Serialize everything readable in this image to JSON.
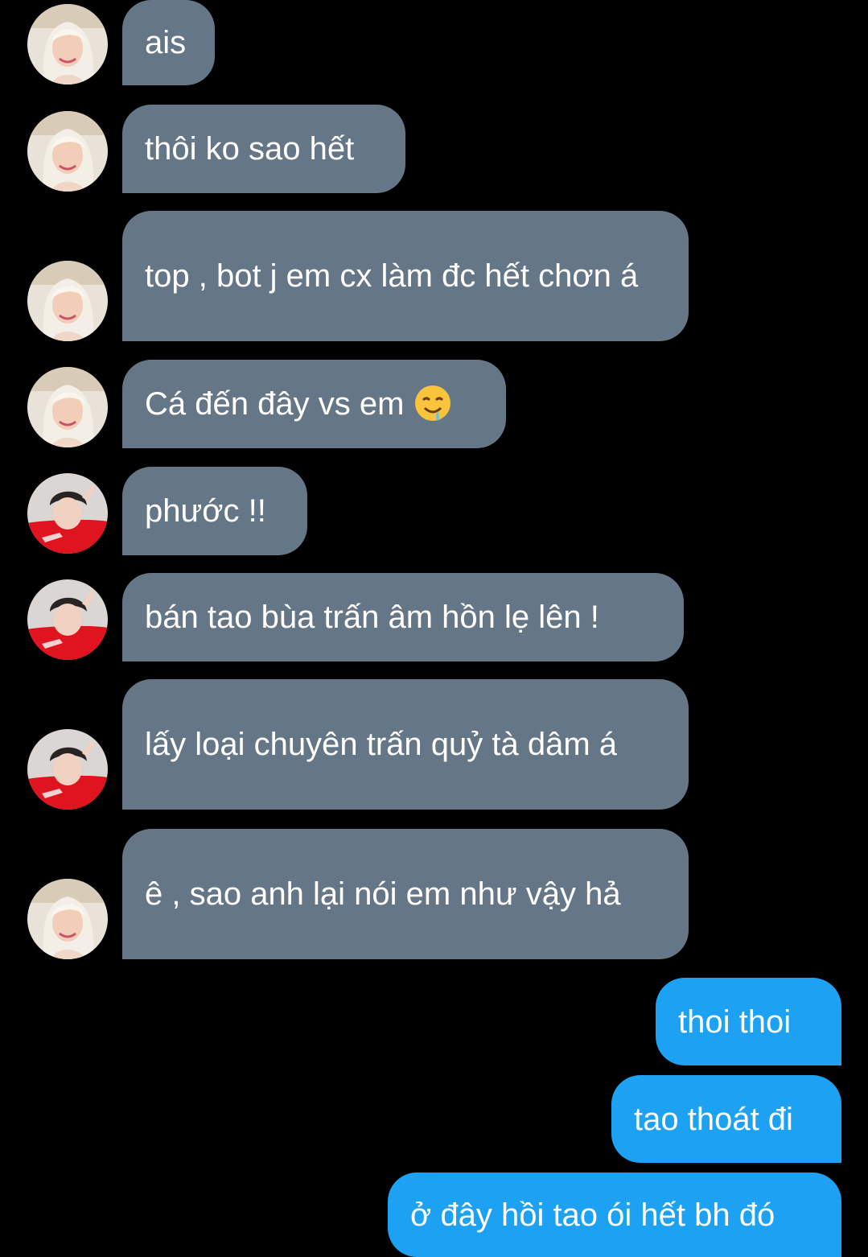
{
  "conversation": {
    "messages": [
      {
        "text": "ais"
      },
      {
        "text": "thôi ko sao hết"
      },
      {
        "text": "top , bot j em cx làm đc hết chơn á"
      },
      {
        "text": "Cá đến đây vs em",
        "emoji": "drooling-face-emoji"
      },
      {
        "text": "phước !!"
      },
      {
        "text": "bán tao bùa trấn âm hồn lẹ lên !"
      },
      {
        "text": "lấy loại chuyên trấn quỷ tà dâm á"
      },
      {
        "text": "ê , sao anh lại nói em như vậy hả"
      },
      {
        "text": "thoi thoi"
      },
      {
        "text": "tao thoát đi"
      },
      {
        "text": "ở đây hồi tao ói hết bh đó"
      }
    ]
  },
  "colors": {
    "background": "#000000",
    "incoming_bubble": "#657786",
    "outgoing_bubble": "#1da1f2",
    "text": "#ffffff"
  }
}
